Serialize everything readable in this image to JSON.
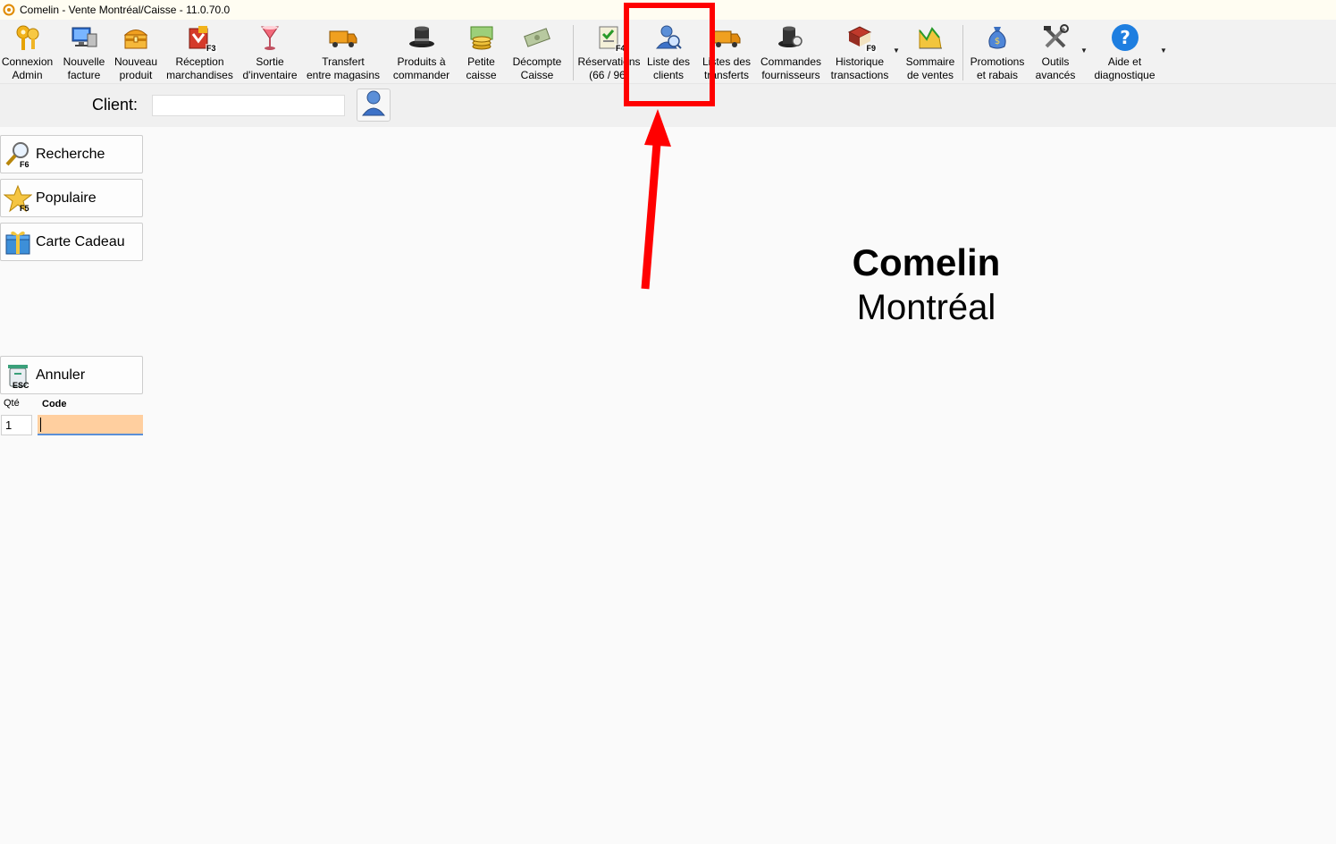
{
  "window": {
    "title": "Comelin - Vente Montréal/Caisse - 11.0.70.0"
  },
  "toolbar": {
    "items": [
      {
        "line1": "Connexion",
        "line2": "Admin",
        "icon": "keys-icon"
      },
      {
        "line1": "Nouvelle",
        "line2": "facture",
        "icon": "computer-icon"
      },
      {
        "line1": "Nouveau",
        "line2": "produit",
        "icon": "treasure-chest-icon"
      },
      {
        "line1": "Réception",
        "line2": "marchandises",
        "icon": "receive-goods-icon",
        "fkey": "F3"
      },
      {
        "line1": "Sortie",
        "line2": "d'inventaire",
        "icon": "cocktail-glass-icon"
      },
      {
        "line1": "Transfert",
        "line2": "entre magasins",
        "icon": "truck-icon"
      },
      {
        "line1": "Produits à",
        "line2": "commander",
        "icon": "top-hat-icon"
      },
      {
        "line1": "Petite",
        "line2": "caisse",
        "icon": "coins-icon"
      },
      {
        "line1": "Décompte",
        "line2": "Caisse",
        "icon": "money-icon"
      },
      {
        "line1": "Réservations",
        "line2": "(66 / 96)",
        "icon": "reservation-icon",
        "fkey": "F4"
      },
      {
        "line1": "Liste des",
        "line2": "clients",
        "icon": "customers-icon"
      },
      {
        "line1": "Listes des",
        "line2": "transferts",
        "icon": "truck-list-icon"
      },
      {
        "line1": "Commandes",
        "line2": "fournisseurs",
        "icon": "top-hat-search-icon"
      },
      {
        "line1": "Historique",
        "line2": "transactions",
        "icon": "book-icon",
        "fkey": "F9"
      },
      {
        "line1": "Sommaire",
        "line2": "de ventes",
        "icon": "chart-icon"
      },
      {
        "line1": "Promotions",
        "line2": "et rabais",
        "icon": "money-bag-icon"
      },
      {
        "line1": "Outils",
        "line2": "avancés",
        "icon": "tools-icon"
      },
      {
        "line1": "Aide et",
        "line2": "diagnostique",
        "icon": "help-icon",
        "glyph": "?"
      }
    ]
  },
  "client": {
    "label": "Client:",
    "value": ""
  },
  "side": {
    "search": {
      "label": "Recherche",
      "fkey": "F6"
    },
    "popular": {
      "label": "Populaire",
      "fkey": "F5"
    },
    "gift": {
      "label": "Carte Cadeau"
    },
    "cancel": {
      "label": "Annuler",
      "fkey": "ESC"
    }
  },
  "entry": {
    "qty_label": "Qté",
    "code_label": "Code",
    "qty_value": "1",
    "code_value": ""
  },
  "brand": {
    "name": "Comelin",
    "city": "Montréal"
  },
  "colors": {
    "highlight": "#ff0000",
    "code_field": "#ffcf9f",
    "help_blue": "#1e7ee0"
  }
}
